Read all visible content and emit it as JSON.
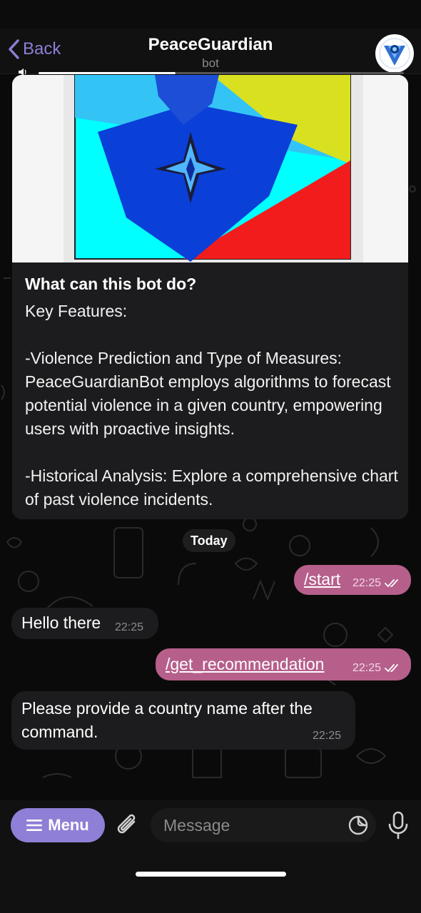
{
  "header": {
    "back_label": "Back",
    "title": "PeaceGuardian",
    "subtitle": "bot"
  },
  "bot_info": {
    "title": "What can this bot do?",
    "body": "Key Features:\n\n-Violence Prediction and Type of Measures: PeaceGuardianBot employs algorithms to forecast potential violence in a given country, empowering users with proactive insights.\n\n-Historical Analysis: Explore a comprehensive chart of past violence incidents."
  },
  "date_separator": "Today",
  "messages": [
    {
      "direction": "out",
      "text": "/start",
      "time": "22:25"
    },
    {
      "direction": "in",
      "text": "Hello there",
      "time": "22:25"
    },
    {
      "direction": "out",
      "text": "/get_recommendation",
      "time": "22:25"
    },
    {
      "direction": "in",
      "text": "Please provide a country name after the command.",
      "time": "22:25"
    }
  ],
  "input_bar": {
    "menu_label": "Menu",
    "message_placeholder": "Message"
  },
  "colors": {
    "accent": "#8f7fd6",
    "outgoing_bubble": "#b65f8b",
    "incoming_bubble": "#1c1c1e"
  }
}
